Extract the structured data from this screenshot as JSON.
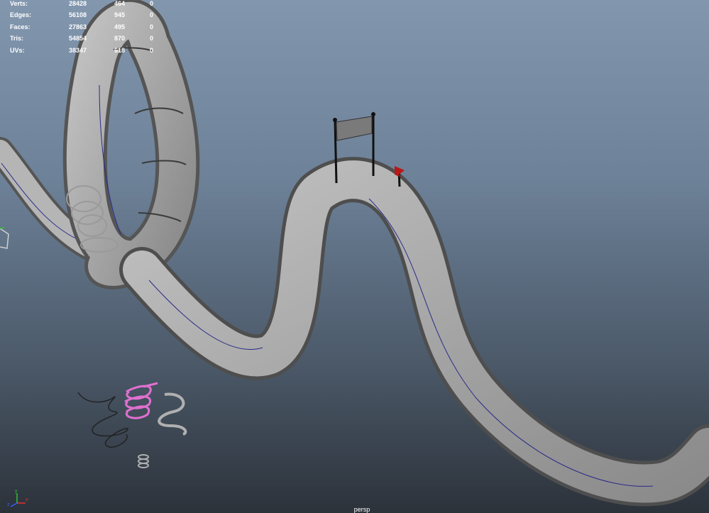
{
  "viewport": {
    "camera_name": "persp",
    "background": {
      "top": "#8297ae",
      "bottom": "#2c323a"
    }
  },
  "heads_up_display": {
    "rows": [
      {
        "label": "Verts:",
        "total": "28428",
        "selected": "464",
        "components": "0"
      },
      {
        "label": "Edges:",
        "total": "56108",
        "selected": "945",
        "components": "0"
      },
      {
        "label": "Faces:",
        "total": "27863",
        "selected": "495",
        "components": "0"
      },
      {
        "label": "Tris:",
        "total": "54854",
        "selected": "870",
        "components": "0"
      },
      {
        "label": "UVs:",
        "total": "38347",
        "selected": "618",
        "components": "0"
      }
    ]
  },
  "axis_gizmo": {
    "labels": [
      "x",
      "y",
      "z"
    ],
    "colors": {
      "x": "#e03030",
      "y": "#30c030",
      "z": "#3060ff"
    }
  },
  "scene_objects": [
    "slide-track",
    "finish-banner",
    "red-flag",
    "spring-coils"
  ],
  "colors": {
    "track": "#a8a8a8",
    "track_shadow": "#5c5c5c",
    "track_line": "#2a2a8a",
    "flag": "#b81818",
    "selected_spring": "#e070d0"
  }
}
